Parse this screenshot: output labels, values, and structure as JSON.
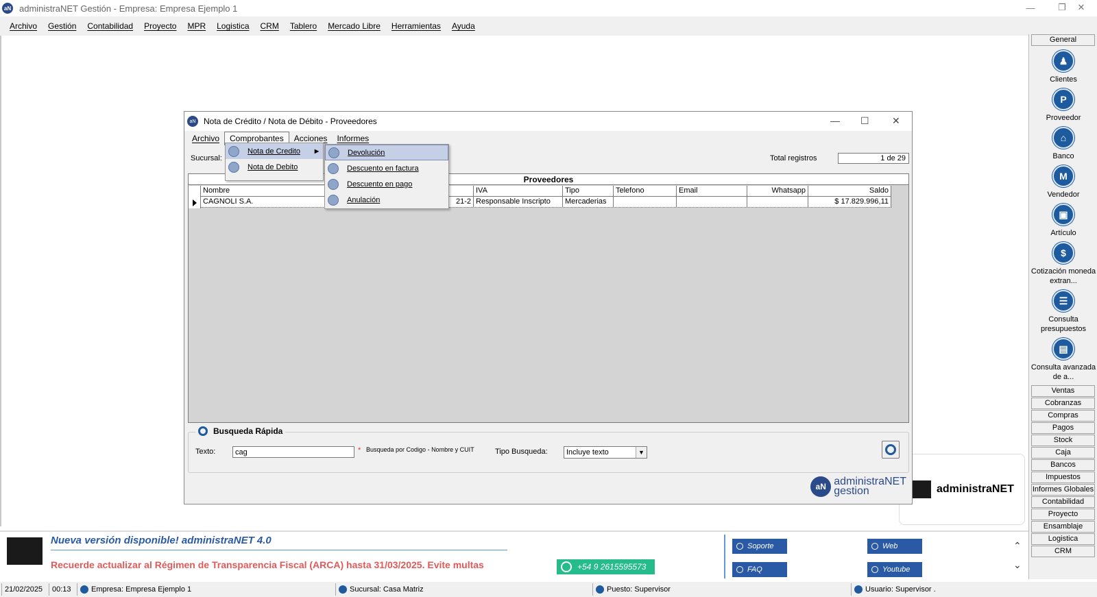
{
  "window": {
    "title": "administraNET Gestión - Empresa: Empresa Ejemplo 1"
  },
  "menubar": [
    "Archivo",
    "Gestión",
    "Contabilidad",
    "Proyecto",
    "MPR",
    "Logistica",
    "CRM",
    "Tablero",
    "Mercado Libre",
    "Herramientas",
    "Ayuda"
  ],
  "sidebar": {
    "header": "General",
    "items": [
      "Clientes",
      "Proveedor",
      "Banco",
      "Vendedor",
      "Artículo",
      "Cotización moneda extran...",
      "Consulta presupuestos",
      "Consulta avanzada de a..."
    ],
    "categories": [
      "Ventas",
      "Cobranzas",
      "Compras",
      "Pagos",
      "Stock",
      "Caja",
      "Bancos",
      "Impuestos",
      "Informes Globales",
      "Contabilidad",
      "Proyecto",
      "Ensamblaje",
      "Logistica",
      "CRM"
    ]
  },
  "dialog": {
    "title": "Nota de Crédito / Nota de Débito - Proveedores",
    "menu": [
      "Archivo",
      "Comprobantes",
      "Acciones",
      "Informes"
    ],
    "sucursal_label": "Sucursal:",
    "total_label": "Total registros",
    "total_value": "1 de 29",
    "grid_band": "Proveedores",
    "columns": [
      "Nombre",
      "",
      "IVA",
      "Tipo",
      "Telefono",
      "Email",
      "Whatsapp",
      "Saldo"
    ],
    "rows": [
      [
        "CAGNOLI S.A.",
        "21-2",
        "Responsable Inscripto",
        "Mercaderias",
        "",
        "",
        "",
        "$ 17.829.996,11"
      ]
    ],
    "quick_search": {
      "title": "Busqueda Rápida",
      "texto_label": "Texto:",
      "texto_value": "cag",
      "hint": "Busqueda por Codigo - Nombre y CUIT",
      "hint_mark": "*",
      "tipo_label": "Tipo Busqueda:",
      "tipo_value": "Incluye texto"
    },
    "logo_line1": "administraNET",
    "logo_line2": "gestion"
  },
  "comprobantes_menu": [
    "Nota de Credito",
    "Nota de Debito"
  ],
  "nota_credito_submenu": [
    "Devolución",
    "Descuento en factura",
    "Descuento en pago",
    "Anulación"
  ],
  "right_logo": "administraNET",
  "bottom": {
    "announce1": "Nueva versión disponible! administraNET 4.0",
    "announce2": "Recuerde actualizar al Régimen de Transparencia Fiscal (ARCA) hasta 31/03/2025. Evite multas",
    "whatsapp": "+54 9 2615595573",
    "links": [
      "Soporte",
      "Web",
      "FAQ",
      "Youtube"
    ]
  },
  "status": {
    "date": "21/02/2025",
    "time": "00:13",
    "empresa": "Empresa: Empresa Ejemplo 1",
    "sucursal": "Sucursal: Casa Matriz",
    "puesto": "Puesto: Supervisor",
    "usuario": "Usuario: Supervisor ."
  },
  "colors": {
    "accent": "#1e5a9e",
    "announce_red": "#e05a5a",
    "whatsapp": "#25bb8a"
  }
}
